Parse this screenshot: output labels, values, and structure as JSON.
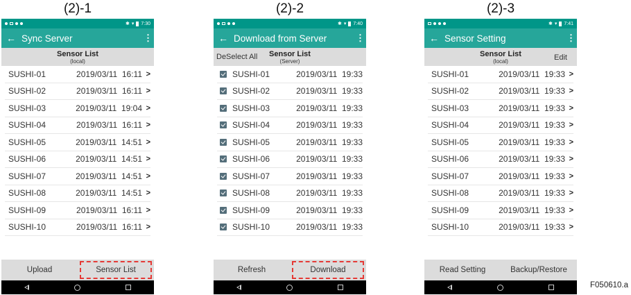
{
  "panels": [
    {
      "caption": "(2)-1",
      "status_time": "7:30",
      "title": "Sync Server",
      "list_title": "Sensor List",
      "list_sub": "(local)",
      "left_action": "",
      "right_action": "",
      "rows": [
        {
          "name": "SUSHI-01",
          "date": "2019/03/11",
          "time": "16:11"
        },
        {
          "name": "SUSHI-02",
          "date": "2019/03/11",
          "time": "16:11"
        },
        {
          "name": "SUSHI-03",
          "date": "2019/03/11",
          "time": "19:04"
        },
        {
          "name": "SUSHI-04",
          "date": "2019/03/11",
          "time": "16:11"
        },
        {
          "name": "SUSHI-05",
          "date": "2019/03/11",
          "time": "14:51"
        },
        {
          "name": "SUSHI-06",
          "date": "2019/03/11",
          "time": "14:51"
        },
        {
          "name": "SUSHI-07",
          "date": "2019/03/11",
          "time": "14:51"
        },
        {
          "name": "SUSHI-08",
          "date": "2019/03/11",
          "time": "14:51"
        },
        {
          "name": "SUSHI-09",
          "date": "2019/03/11",
          "time": "16:11"
        },
        {
          "name": "SUSHI-10",
          "date": "2019/03/11",
          "time": "16:11"
        }
      ],
      "buttons": [
        "Upload",
        "Sensor List"
      ]
    },
    {
      "caption": "(2)-2",
      "status_time": "7:40",
      "title": "Download from Server",
      "list_title": "Sensor List",
      "list_sub": "(Server)",
      "left_action": "DeSelect All",
      "right_action": "",
      "rows": [
        {
          "name": "SUSHI-01",
          "date": "2019/03/11",
          "time": "19:33"
        },
        {
          "name": "SUSHI-02",
          "date": "2019/03/11",
          "time": "19:33"
        },
        {
          "name": "SUSHI-03",
          "date": "2019/03/11",
          "time": "19:33"
        },
        {
          "name": "SUSHI-04",
          "date": "2019/03/11",
          "time": "19:33"
        },
        {
          "name": "SUSHI-05",
          "date": "2019/03/11",
          "time": "19:33"
        },
        {
          "name": "SUSHI-06",
          "date": "2019/03/11",
          "time": "19:33"
        },
        {
          "name": "SUSHI-07",
          "date": "2019/03/11",
          "time": "19:33"
        },
        {
          "name": "SUSHI-08",
          "date": "2019/03/11",
          "time": "19:33"
        },
        {
          "name": "SUSHI-09",
          "date": "2019/03/11",
          "time": "19:33"
        },
        {
          "name": "SUSHI-10",
          "date": "2019/03/11",
          "time": "19:33"
        }
      ],
      "buttons": [
        "Refresh",
        "Download"
      ]
    },
    {
      "caption": "(2)-3",
      "status_time": "7:41",
      "title": "Sensor Setting",
      "list_title": "Sensor List",
      "list_sub": "(local)",
      "left_action": "",
      "right_action": "Edit",
      "rows": [
        {
          "name": "SUSHI-01",
          "date": "2019/03/11",
          "time": "19:33"
        },
        {
          "name": "SUSHI-02",
          "date": "2019/03/11",
          "time": "19:33"
        },
        {
          "name": "SUSHI-03",
          "date": "2019/03/11",
          "time": "19:33"
        },
        {
          "name": "SUSHI-04",
          "date": "2019/03/11",
          "time": "19:33"
        },
        {
          "name": "SUSHI-05",
          "date": "2019/03/11",
          "time": "19:33"
        },
        {
          "name": "SUSHI-06",
          "date": "2019/03/11",
          "time": "19:33"
        },
        {
          "name": "SUSHI-07",
          "date": "2019/03/11",
          "time": "19:33"
        },
        {
          "name": "SUSHI-08",
          "date": "2019/03/11",
          "time": "19:33"
        },
        {
          "name": "SUSHI-09",
          "date": "2019/03/11",
          "time": "19:33"
        },
        {
          "name": "SUSHI-10",
          "date": "2019/03/11",
          "time": "19:33"
        }
      ],
      "buttons": [
        "Read Setting",
        "Backup/Restore"
      ]
    }
  ],
  "icons": {
    "back": "arrow-back-icon",
    "menu": "overflow-menu-icon",
    "chevron": "chevron-right-icon",
    "check": "checkbox-checked-icon"
  },
  "colors": {
    "status_bar": "#009688",
    "app_bar": "#26a69a",
    "highlight": "#e53935"
  },
  "figure_label": "F050610.a"
}
